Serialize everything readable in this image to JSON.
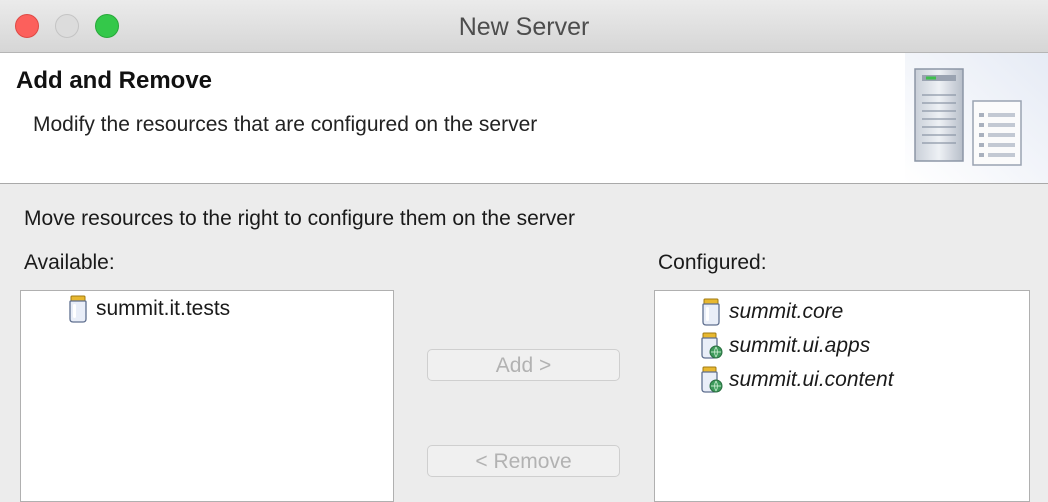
{
  "window": {
    "title": "New Server"
  },
  "header": {
    "title": "Add and Remove",
    "description": "Modify the resources that are configured on the server"
  },
  "instruction": "Move resources to the right to configure them on the server",
  "available": {
    "label": "Available:",
    "items": [
      {
        "label": "summit.it.tests",
        "icon": "bundle-icon"
      }
    ]
  },
  "configured": {
    "label": "Configured:",
    "items": [
      {
        "label": "summit.core",
        "icon": "bundle-icon"
      },
      {
        "label": "summit.ui.apps",
        "icon": "bundle-web-icon"
      },
      {
        "label": "summit.ui.content",
        "icon": "bundle-web-icon"
      }
    ]
  },
  "buttons": {
    "add": "Add >",
    "remove": "< Remove"
  }
}
